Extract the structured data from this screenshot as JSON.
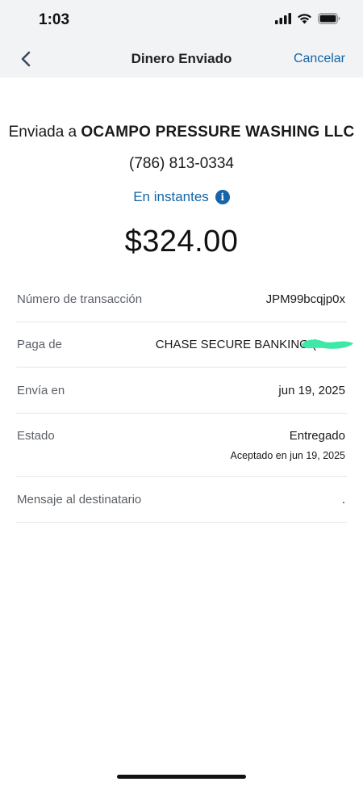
{
  "status": {
    "time": "1:03"
  },
  "nav": {
    "back_icon": "chevron-left-icon",
    "title": "Dinero Enviado",
    "cancel": "Cancelar"
  },
  "transfer": {
    "sent_to_prefix": "Enviada a ",
    "recipient_name": "OCAMPO PRESSURE WASHING LLC",
    "phone": "(786) 813-0334",
    "speed": "En instantes",
    "amount": "$324.00"
  },
  "details": {
    "transaction_label": "Número de transacción",
    "transaction_value": "JPM99bcqjp0x",
    "from_label": "Paga de",
    "from_value": "CHASE SECURE BANKING (",
    "send_on_label": "Envía en",
    "send_on_value": "jun 19, 2025",
    "status_label": "Estado",
    "status_value": "Entregado",
    "status_sub": "Aceptado en jun 19, 2025",
    "message_label": "Mensaje al destinatario",
    "message_value": "."
  },
  "colors": {
    "accent": "#1565a8",
    "header_bg": "#f2f3f5",
    "redaction": "#3ee8a6"
  }
}
